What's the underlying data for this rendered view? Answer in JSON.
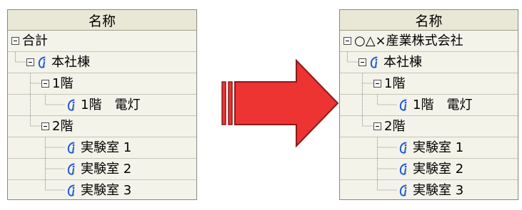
{
  "left_panel": {
    "header": "名称",
    "rows": [
      {
        "label": "合計",
        "toggle": true,
        "icon": false,
        "level": 0
      },
      {
        "label": "本社棟",
        "toggle": true,
        "icon": true,
        "level": 1
      },
      {
        "label": "1階",
        "toggle": true,
        "icon": false,
        "level": 2
      },
      {
        "label": "1階　電灯",
        "toggle": false,
        "icon": true,
        "level": 3
      },
      {
        "label": "2階",
        "toggle": true,
        "icon": false,
        "level": 2
      },
      {
        "label": "実験室 1",
        "toggle": false,
        "icon": true,
        "level": 3
      },
      {
        "label": "実験室 2",
        "toggle": false,
        "icon": true,
        "level": 3
      },
      {
        "label": "実験室 3",
        "toggle": false,
        "icon": true,
        "level": 3
      }
    ]
  },
  "right_panel": {
    "header": "名称",
    "rows": [
      {
        "label": "○△×産業株式会社",
        "toggle": true,
        "icon": false,
        "level": 0
      },
      {
        "label": "本社棟",
        "toggle": true,
        "icon": true,
        "level": 1
      },
      {
        "label": "1階",
        "toggle": true,
        "icon": false,
        "level": 2
      },
      {
        "label": "1階　電灯",
        "toggle": false,
        "icon": true,
        "level": 3
      },
      {
        "label": "2階",
        "toggle": true,
        "icon": false,
        "level": 2
      },
      {
        "label": "実験室 1",
        "toggle": false,
        "icon": true,
        "level": 3
      },
      {
        "label": "実験室 2",
        "toggle": false,
        "icon": true,
        "level": 3
      },
      {
        "label": "実験室 3",
        "toggle": false,
        "icon": true,
        "level": 3
      }
    ]
  },
  "icons": {
    "collapse": "minus-box-icon",
    "item": "info-icon",
    "arrow": "right-arrow-icon"
  },
  "colors": {
    "arrow_fill": "#ee3333",
    "arrow_stroke": "#8b1a1a",
    "panel_bg": "#f4f3ea",
    "info_icon": "#1f5ad6"
  }
}
